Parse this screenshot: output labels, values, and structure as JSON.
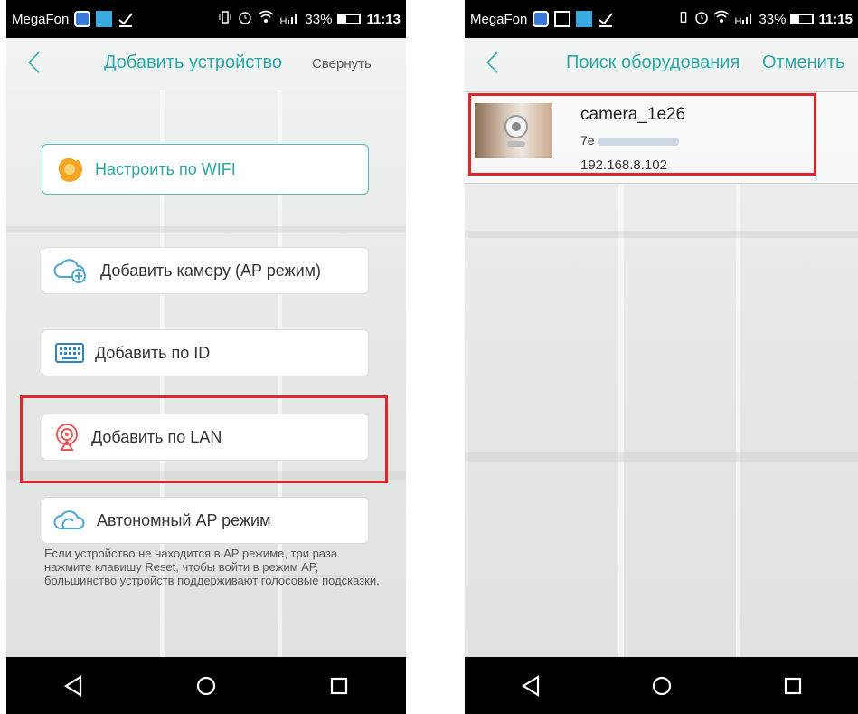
{
  "left_screen": {
    "status": {
      "carrier": "MegaFon",
      "signal": "H",
      "battery": "33%",
      "time": "11:13"
    },
    "header": {
      "title": "Добавить устройство",
      "action": "Свернуть"
    },
    "buttons": [
      {
        "label": "Настроить по WIFI",
        "icon": "wifi-setup-icon"
      },
      {
        "label": "Добавить камеру (AP режим)",
        "icon": "cloud-add-icon"
      },
      {
        "label": "Добавить по ID",
        "icon": "keyboard-icon"
      },
      {
        "label": "Добавить по LAN",
        "icon": "lan-search-icon",
        "highlighted": true
      },
      {
        "label": "Автономный AP режим",
        "icon": "cloud-icon"
      }
    ],
    "hint": "Если устройство не находится в AP режиме, три раза нажмите клавишу Reset, чтобы войти в режим AP, большинство устройств поддерживают голосовые подсказки."
  },
  "right_screen": {
    "status": {
      "carrier": "MegaFon",
      "signal": "H",
      "battery": "33%",
      "time": "11:15"
    },
    "header": {
      "title": "Поиск оборудования",
      "action": "Отменить"
    },
    "device": {
      "name": "camera_1e26",
      "id_prefix": "7e",
      "ip": "192.168.8.102",
      "highlighted": true
    }
  },
  "colors": {
    "accent": "#2aa9a8",
    "highlight": "#e4242b"
  }
}
